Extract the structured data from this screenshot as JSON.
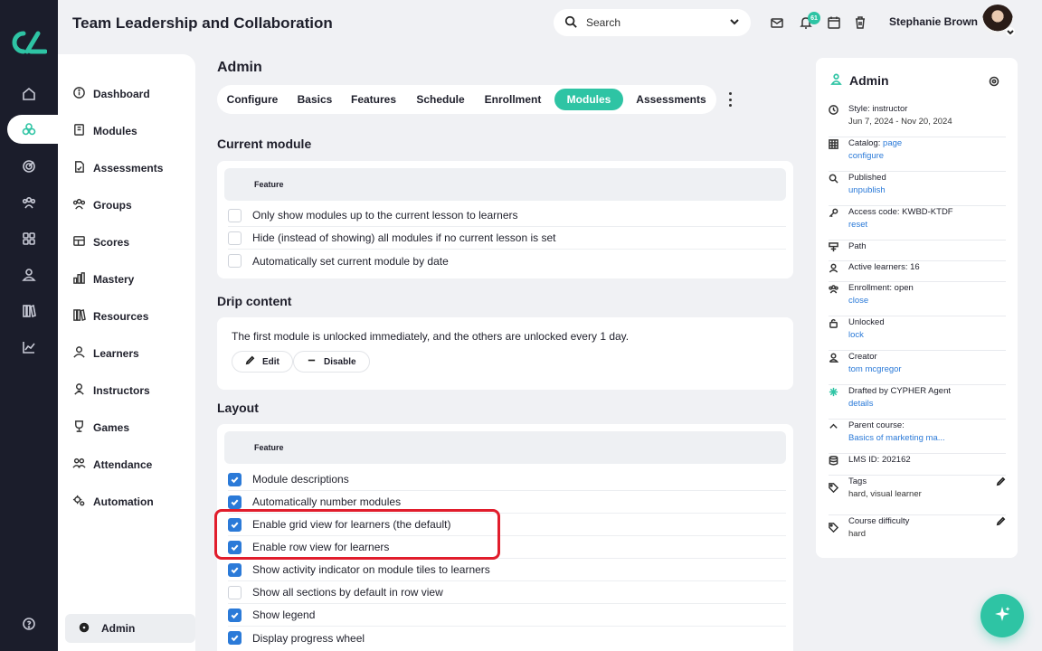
{
  "header": {
    "title": "Team Leadership and Collaboration",
    "search_placeholder": "Search",
    "notification_count": "61",
    "user_name": "Stephanie Brown"
  },
  "rail": {
    "icons": [
      "home-icon",
      "modules-icon",
      "target-icon",
      "groups-icon",
      "grid-icon",
      "person-icon",
      "library-icon",
      "chart-icon",
      "help-icon"
    ]
  },
  "subnav": {
    "items": [
      {
        "label": "Dashboard",
        "icon": "info-icon"
      },
      {
        "label": "Modules",
        "icon": "book-icon"
      },
      {
        "label": "Assessments",
        "icon": "assessment-icon"
      },
      {
        "label": "Groups",
        "icon": "groups-icon"
      },
      {
        "label": "Scores",
        "icon": "table-icon"
      },
      {
        "label": "Mastery",
        "icon": "bars-icon"
      },
      {
        "label": "Resources",
        "icon": "library-icon"
      },
      {
        "label": "Learners",
        "icon": "person-icon"
      },
      {
        "label": "Instructors",
        "icon": "instructor-icon"
      },
      {
        "label": "Games",
        "icon": "trophy-icon"
      },
      {
        "label": "Attendance",
        "icon": "attendance-icon"
      },
      {
        "label": "Automation",
        "icon": "automation-icon"
      }
    ],
    "footer_label": "Admin"
  },
  "main": {
    "heading": "Admin",
    "tabs": [
      "Configure",
      "Basics",
      "Features",
      "Schedule",
      "Enrollment",
      "Modules",
      "Assessments"
    ],
    "active_tab": "Modules",
    "current_module": {
      "title": "Current module",
      "column": "Feature",
      "rows": [
        {
          "label": "Only show modules up to the current lesson to learners",
          "checked": false
        },
        {
          "label": "Hide (instead of showing) all modules if no current lesson is set",
          "checked": false
        },
        {
          "label": "Automatically set current module by date",
          "checked": false
        }
      ]
    },
    "drip": {
      "title": "Drip content",
      "text": "The first module is unlocked immediately, and the others are unlocked every 1 day.",
      "edit_label": "Edit",
      "disable_label": "Disable"
    },
    "layout": {
      "title": "Layout",
      "column": "Feature",
      "rows": [
        {
          "label": "Module descriptions",
          "checked": true
        },
        {
          "label": "Automatically number modules",
          "checked": true
        },
        {
          "label": "Enable grid view for learners (the default)",
          "checked": true
        },
        {
          "label": "Enable row view for learners",
          "checked": true
        },
        {
          "label": "Show activity indicator on module tiles to learners",
          "checked": true
        },
        {
          "label": "Show all sections by default in row view",
          "checked": false
        },
        {
          "label": "Show legend",
          "checked": true
        },
        {
          "label": "Display progress wheel",
          "checked": true
        }
      ]
    }
  },
  "panel": {
    "title": "Admin",
    "rows": [
      {
        "label": "Style: instructor",
        "sub": "Jun 7, 2024 - Nov 20, 2024",
        "icon": "clock-icon"
      },
      {
        "label": "Catalog:",
        "inline_link": "page",
        "link": "configure",
        "icon": "grid-icon"
      },
      {
        "label": "Published",
        "link": "unpublish",
        "icon": "search-icon"
      },
      {
        "label": "Access code: KWBD-KTDF",
        "link": "reset",
        "icon": "key-icon"
      },
      {
        "label": "Path",
        "icon": "path-icon"
      },
      {
        "label": "Active learners: 16",
        "icon": "person-icon"
      },
      {
        "label": "Enrollment: open",
        "link": "close",
        "icon": "groups-icon"
      },
      {
        "label": "Unlocked",
        "link": "lock",
        "icon": "lock-icon"
      },
      {
        "label": "Creator",
        "link": "tom mcgregor",
        "icon": "creator-icon"
      },
      {
        "label": "Drafted by CYPHER Agent",
        "link": "details",
        "icon": "sparkle-icon"
      },
      {
        "label": "Parent course:",
        "link": "Basics of marketing ma...",
        "icon": "chevron-up-icon"
      },
      {
        "label": "LMS ID: 202162",
        "icon": "database-icon"
      },
      {
        "label": "Tags",
        "sub": "hard, visual learner",
        "icon": "tag-icon",
        "editable": true
      },
      {
        "label": "Course difficulty",
        "sub": "hard",
        "icon": "tag-icon",
        "editable": true
      }
    ]
  },
  "colors": {
    "accent": "#2ec4a4",
    "link": "#2b7ad8",
    "checkbox": "#2b7ad8",
    "highlight": "#e11d2c",
    "rail": "#1b1d2b"
  }
}
